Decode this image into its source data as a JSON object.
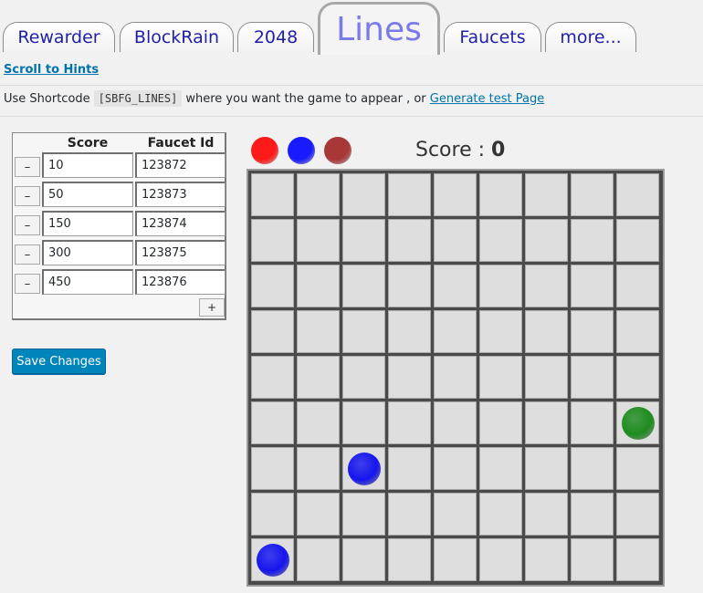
{
  "tabs": [
    {
      "label": "Rewarder",
      "active": false
    },
    {
      "label": "BlockRain",
      "active": false
    },
    {
      "label": "2048",
      "active": false
    },
    {
      "label": "Lines",
      "active": true
    },
    {
      "label": "Faucets",
      "active": false
    },
    {
      "label": "more...",
      "active": false
    }
  ],
  "hints_link": "Scroll to Hints",
  "shortcode": {
    "prefix": "Use Shortcode",
    "code": "[SBFG_LINES]",
    "middle": "where you want the game to appear , or",
    "link": "Generate test Page"
  },
  "settings_table": {
    "headers": [
      "Score",
      "Faucet Id"
    ],
    "rows": [
      {
        "score": "10",
        "faucet_id": "123872"
      },
      {
        "score": "50",
        "faucet_id": "123873"
      },
      {
        "score": "150",
        "faucet_id": "123874"
      },
      {
        "score": "300",
        "faucet_id": "123875"
      },
      {
        "score": "450",
        "faucet_id": "123876"
      }
    ],
    "remove_label": "–",
    "add_label": "+"
  },
  "save_button": "Save Changes",
  "game": {
    "score_label": "Score :",
    "score_value": "0",
    "next_balls": [
      "#ff1a1a",
      "#1a1aff",
      "#a83838"
    ],
    "grid_size": 9,
    "balls": [
      {
        "row": 5,
        "col": 8,
        "color": "green"
      },
      {
        "row": 6,
        "col": 2,
        "color": "blue"
      },
      {
        "row": 8,
        "col": 0,
        "color": "blue"
      }
    ],
    "colors": {
      "green": "#1e8c1e",
      "blue": "#1515ee"
    }
  }
}
